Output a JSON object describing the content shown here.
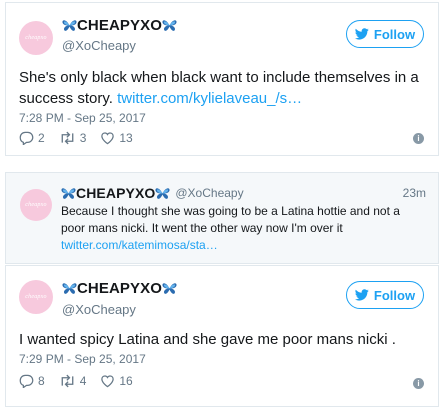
{
  "tweets": [
    {
      "display_name": "CHEAPYXO",
      "handle": "@XoCheapy",
      "follow_label": "Follow",
      "text": "She's only black when black want to include themselves in a success story.",
      "link": "twitter.com/kylielaveau_/s…",
      "timestamp": "7:28 PM - Sep 25, 2017",
      "replies": "2",
      "retweets": "3",
      "likes": "13"
    },
    {
      "display_name": "CHEAPYXO",
      "handle": "@XoCheapy",
      "age": "23m",
      "text": "Because I thought she was going to be a Latina hottie and not a poor mans nicki. It went the other way now I'm over it",
      "link": "twitter.com/katemimosa/sta…"
    },
    {
      "display_name": "CHEAPYXO",
      "handle": "@XoCheapy",
      "follow_label": "Follow",
      "text": "I wanted spicy Latina and she gave me poor mans nicki .",
      "timestamp": "7:29 PM - Sep 25, 2017",
      "replies": "8",
      "retweets": "4",
      "likes": "16"
    }
  ],
  "avatar_text": "cheapxo",
  "colors": {
    "accent": "#1da1f2",
    "muted": "#657786",
    "butterfly": "#2b6cb0",
    "avatar_bg": "#f7c9dd"
  },
  "icons": [
    "butterfly-icon",
    "twitter-bird-icon",
    "reply-icon",
    "retweet-icon",
    "like-icon",
    "info-icon"
  ]
}
